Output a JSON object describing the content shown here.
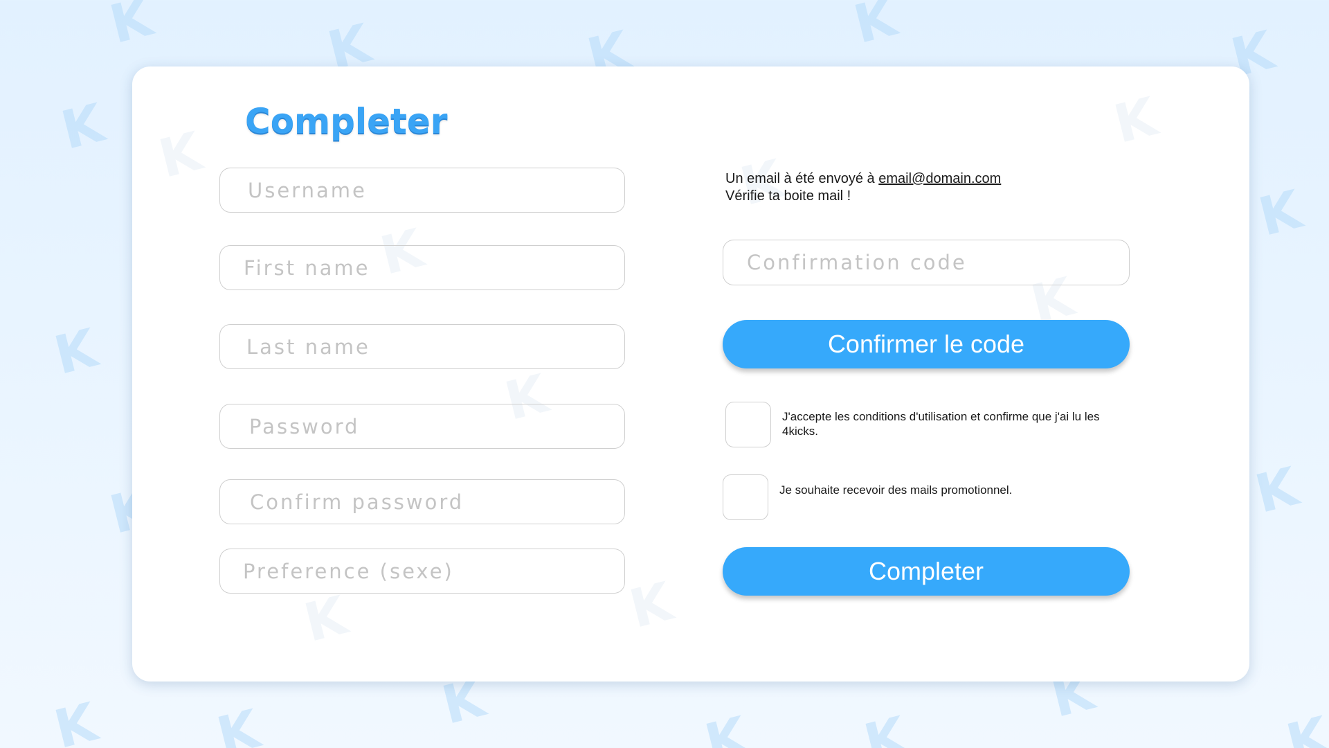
{
  "background": {
    "watermark_char": "࿥K",
    "color": "#e2f1ff"
  },
  "title": "Completer",
  "form": {
    "fields": [
      {
        "name": "username-input",
        "placeholder": "Username",
        "value": ""
      },
      {
        "name": "first-name-input",
        "placeholder": "First name",
        "value": ""
      },
      {
        "name": "last-name-input",
        "placeholder": "Last name",
        "value": ""
      },
      {
        "name": "password-input",
        "placeholder": "Password",
        "value": ""
      },
      {
        "name": "confirm-password-input",
        "placeholder": "Confirm password",
        "value": ""
      },
      {
        "name": "preference-input",
        "placeholder": "Preference (sexe)",
        "value": ""
      }
    ]
  },
  "email_notice": {
    "prefix": "Un email à été envoyé à ",
    "email": "email@domain.com",
    "line2": "Vérifie ta boite mail !"
  },
  "confirmation": {
    "placeholder": "Confirmation code",
    "value": "",
    "button_label": "Confirmer le code"
  },
  "terms": {
    "checked": false,
    "label": "J'accepte les conditions d'utilisation et confirme que j'ai lu les 4kicks."
  },
  "promo": {
    "checked": false,
    "label": "Je souhaite recevoir des mails promotionnel."
  },
  "submit_label": "Completer",
  "colors": {
    "accent": "#36a9fb",
    "title": "#3aa4f5",
    "border": "#cfcfcf",
    "placeholder": "#c4c4c4"
  }
}
